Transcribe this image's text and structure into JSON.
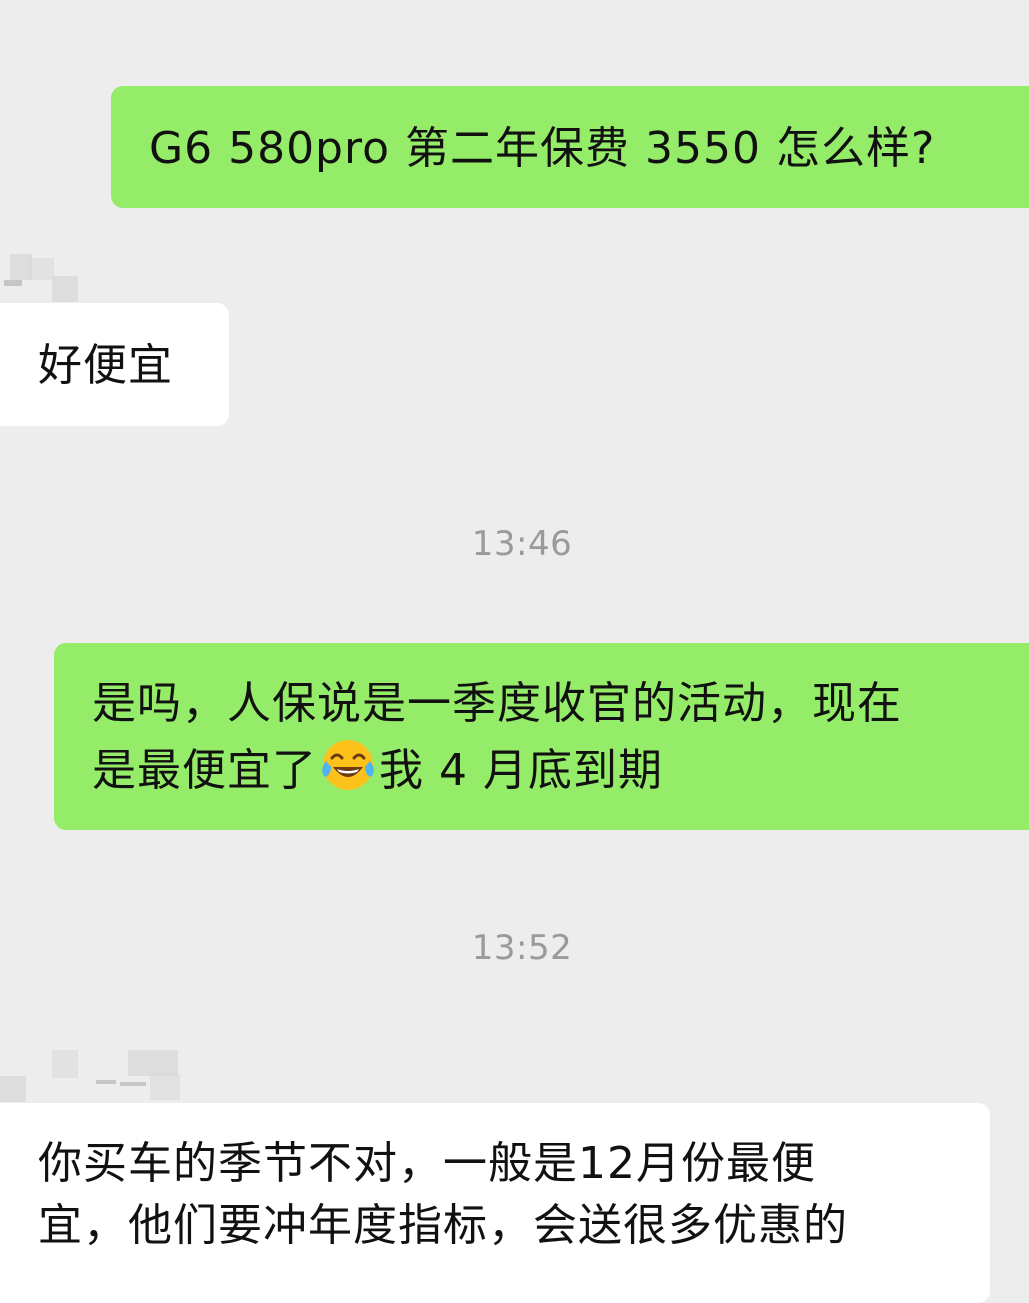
{
  "messages": [
    {
      "id": "msg1",
      "side": "sent",
      "lines": [
        "G6 580pro  第二年保费 3550 怎么样?"
      ]
    },
    {
      "id": "msg2",
      "side": "received",
      "lines": [
        "好便宜"
      ]
    },
    {
      "id": "msg3",
      "side": "sent",
      "lines": [
        "是吗，人保说是一季度收官的活动，现在",
        "是最便宜了",
        "我 4 月底到期"
      ],
      "emoji": "face-with-tears-of-joy"
    },
    {
      "id": "msg4",
      "side": "received",
      "lines": [
        "你买车的季节不对，一般是12月份最便",
        "宜，他们要冲年度指标，会送很多优惠的"
      ]
    }
  ],
  "timestamps": [
    "13:46",
    "13:52"
  ],
  "colors": {
    "background": "#ededed",
    "sent_bubble": "#95ec69",
    "received_bubble": "#ffffff",
    "timestamp_text": "#9a9a9a"
  }
}
